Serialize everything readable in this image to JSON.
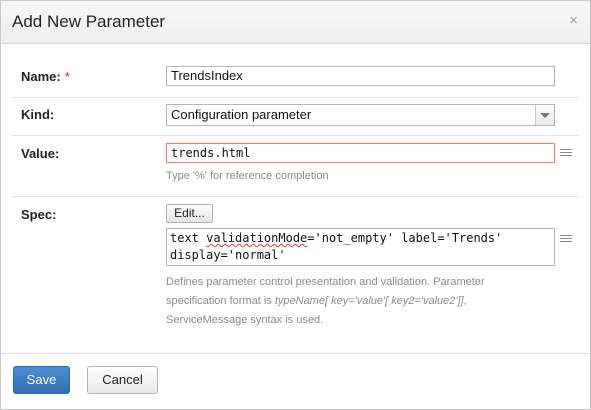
{
  "dialog": {
    "title": "Add New Parameter",
    "close_icon": "×"
  },
  "fields": {
    "name": {
      "label": "Name:",
      "required_mark": "*",
      "value": "TrendsIndex"
    },
    "kind": {
      "label": "Kind:",
      "value": "Configuration parameter"
    },
    "value": {
      "label": "Value:",
      "value": "trends.html",
      "hint": "Type '%' for reference completion"
    },
    "spec": {
      "label": "Spec:",
      "edit_button": "Edit...",
      "line1_prefix": "text ",
      "line1_misspelled": "validationMode",
      "line1_suffix": "='not_empty' label='Trends'",
      "line2": "display='normal'",
      "hint_part1": "Defines parameter control presentation and validation. Parameter",
      "hint_part2": "specification format is ",
      "hint_format": "typeName[ key='value'[ key2='value2']]",
      "hint_part3": ",",
      "hint_part4": "ServiceMessage syntax is used."
    }
  },
  "footer": {
    "save_label": "Save",
    "cancel_label": "Cancel"
  },
  "icons": {
    "close": "close-icon",
    "value_expand": "list-icon",
    "spec_expand": "list-icon",
    "kind_dropdown": "chevron-down-icon"
  },
  "colors": {
    "primary_button": "#3a7cc1",
    "required_mark": "#d9241b",
    "focus_border": "#e08a6f"
  }
}
